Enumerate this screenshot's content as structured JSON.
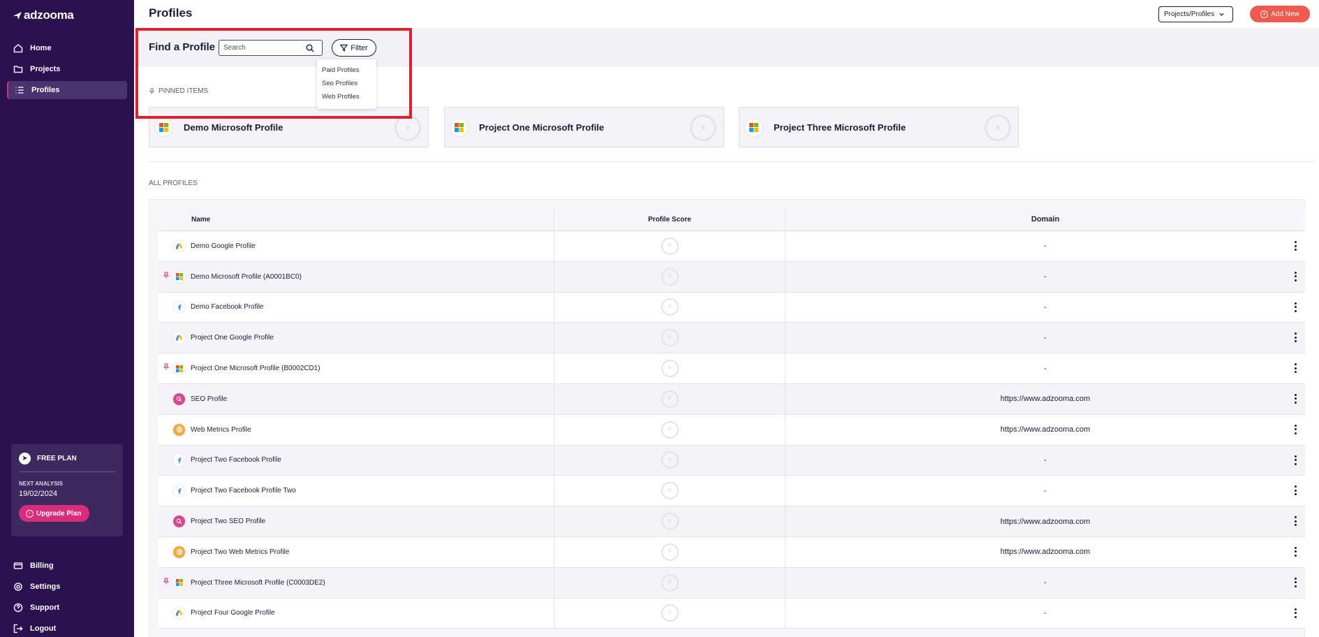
{
  "app": {
    "logo_text": "adzooma"
  },
  "sidebar": {
    "nav": [
      {
        "label": "Home",
        "icon": "home-icon"
      },
      {
        "label": "Projects",
        "icon": "folder-icon"
      },
      {
        "label": "Profiles",
        "icon": "list-icon",
        "active": true
      }
    ],
    "plan": {
      "name": "FREE PLAN",
      "next_label": "NEXT ANALYSIS",
      "next_date": "19/02/2024",
      "upgrade_label": "Upgrade Plan"
    },
    "bottom_nav": [
      {
        "label": "Billing",
        "icon": "billing-icon"
      },
      {
        "label": "Settings",
        "icon": "gear-icon"
      },
      {
        "label": "Support",
        "icon": "help-icon"
      },
      {
        "label": "Logout",
        "icon": "logout-icon"
      }
    ]
  },
  "header": {
    "title": "Profiles",
    "select_label": "Projects/Profiles",
    "add_label": "Add New"
  },
  "find": {
    "title": "Find a Profile",
    "search_placeholder": "Search",
    "filter_label": "Filter",
    "filter_options": [
      "Paid Profiles",
      "Seo Profiles",
      "Web Profiles"
    ]
  },
  "pinned": {
    "label": "PINNED ITEMS",
    "items": [
      {
        "name": "Demo Microsoft Profile",
        "score": "0"
      },
      {
        "name": "Project One Microsoft Profile",
        "score": "0"
      },
      {
        "name": "Project Three Microsoft Profile",
        "score": "0"
      }
    ]
  },
  "all_profiles": {
    "label": "ALL PROFILES",
    "columns": [
      "Name",
      "Profile Score",
      "Domain"
    ],
    "rows": [
      {
        "name": "Demo Google Profile",
        "type": "google",
        "pinned": false,
        "score": "0",
        "domain": "-"
      },
      {
        "name": "Demo Microsoft Profile (A0001BC0)",
        "type": "microsoft",
        "pinned": true,
        "score": "0",
        "domain": "-"
      },
      {
        "name": "Demo Facebook Profile",
        "type": "facebook",
        "pinned": false,
        "score": "0",
        "domain": "-"
      },
      {
        "name": "Project One Google Profile",
        "type": "google",
        "pinned": false,
        "score": "0",
        "domain": "-"
      },
      {
        "name": "Project One Microsoft Profile (B0002CD1)",
        "type": "microsoft",
        "pinned": true,
        "score": "0",
        "domain": "-"
      },
      {
        "name": "SEO Profile",
        "type": "seo",
        "pinned": false,
        "score": "0",
        "domain": "https://www.adzooma.com"
      },
      {
        "name": "Web Metrics Profile",
        "type": "web",
        "pinned": false,
        "score": "0",
        "domain": "https://www.adzooma.com"
      },
      {
        "name": "Project Two Facebook Profile",
        "type": "facebook",
        "pinned": false,
        "score": "0",
        "domain": "-"
      },
      {
        "name": "Project Two Facebook Profile Two",
        "type": "facebook",
        "pinned": false,
        "score": "0",
        "domain": "-"
      },
      {
        "name": "Project Two SEO Profile",
        "type": "seo",
        "pinned": false,
        "score": "0",
        "domain": "https://www.adzooma.com"
      },
      {
        "name": "Project Two Web Metrics Profile",
        "type": "web",
        "pinned": false,
        "score": "0",
        "domain": "https://www.adzooma.com"
      },
      {
        "name": "Project Three Microsoft Profile (C0003DE2)",
        "type": "microsoft",
        "pinned": true,
        "score": "0",
        "domain": "-"
      },
      {
        "name": "Project Four Google Profile",
        "type": "google",
        "pinned": false,
        "score": "0",
        "domain": "-"
      }
    ]
  },
  "colors": {
    "sidebar": "#2a1250",
    "accent": "#d92d7b",
    "add_button": "#ef5a4f",
    "highlight": "#e0202e"
  }
}
